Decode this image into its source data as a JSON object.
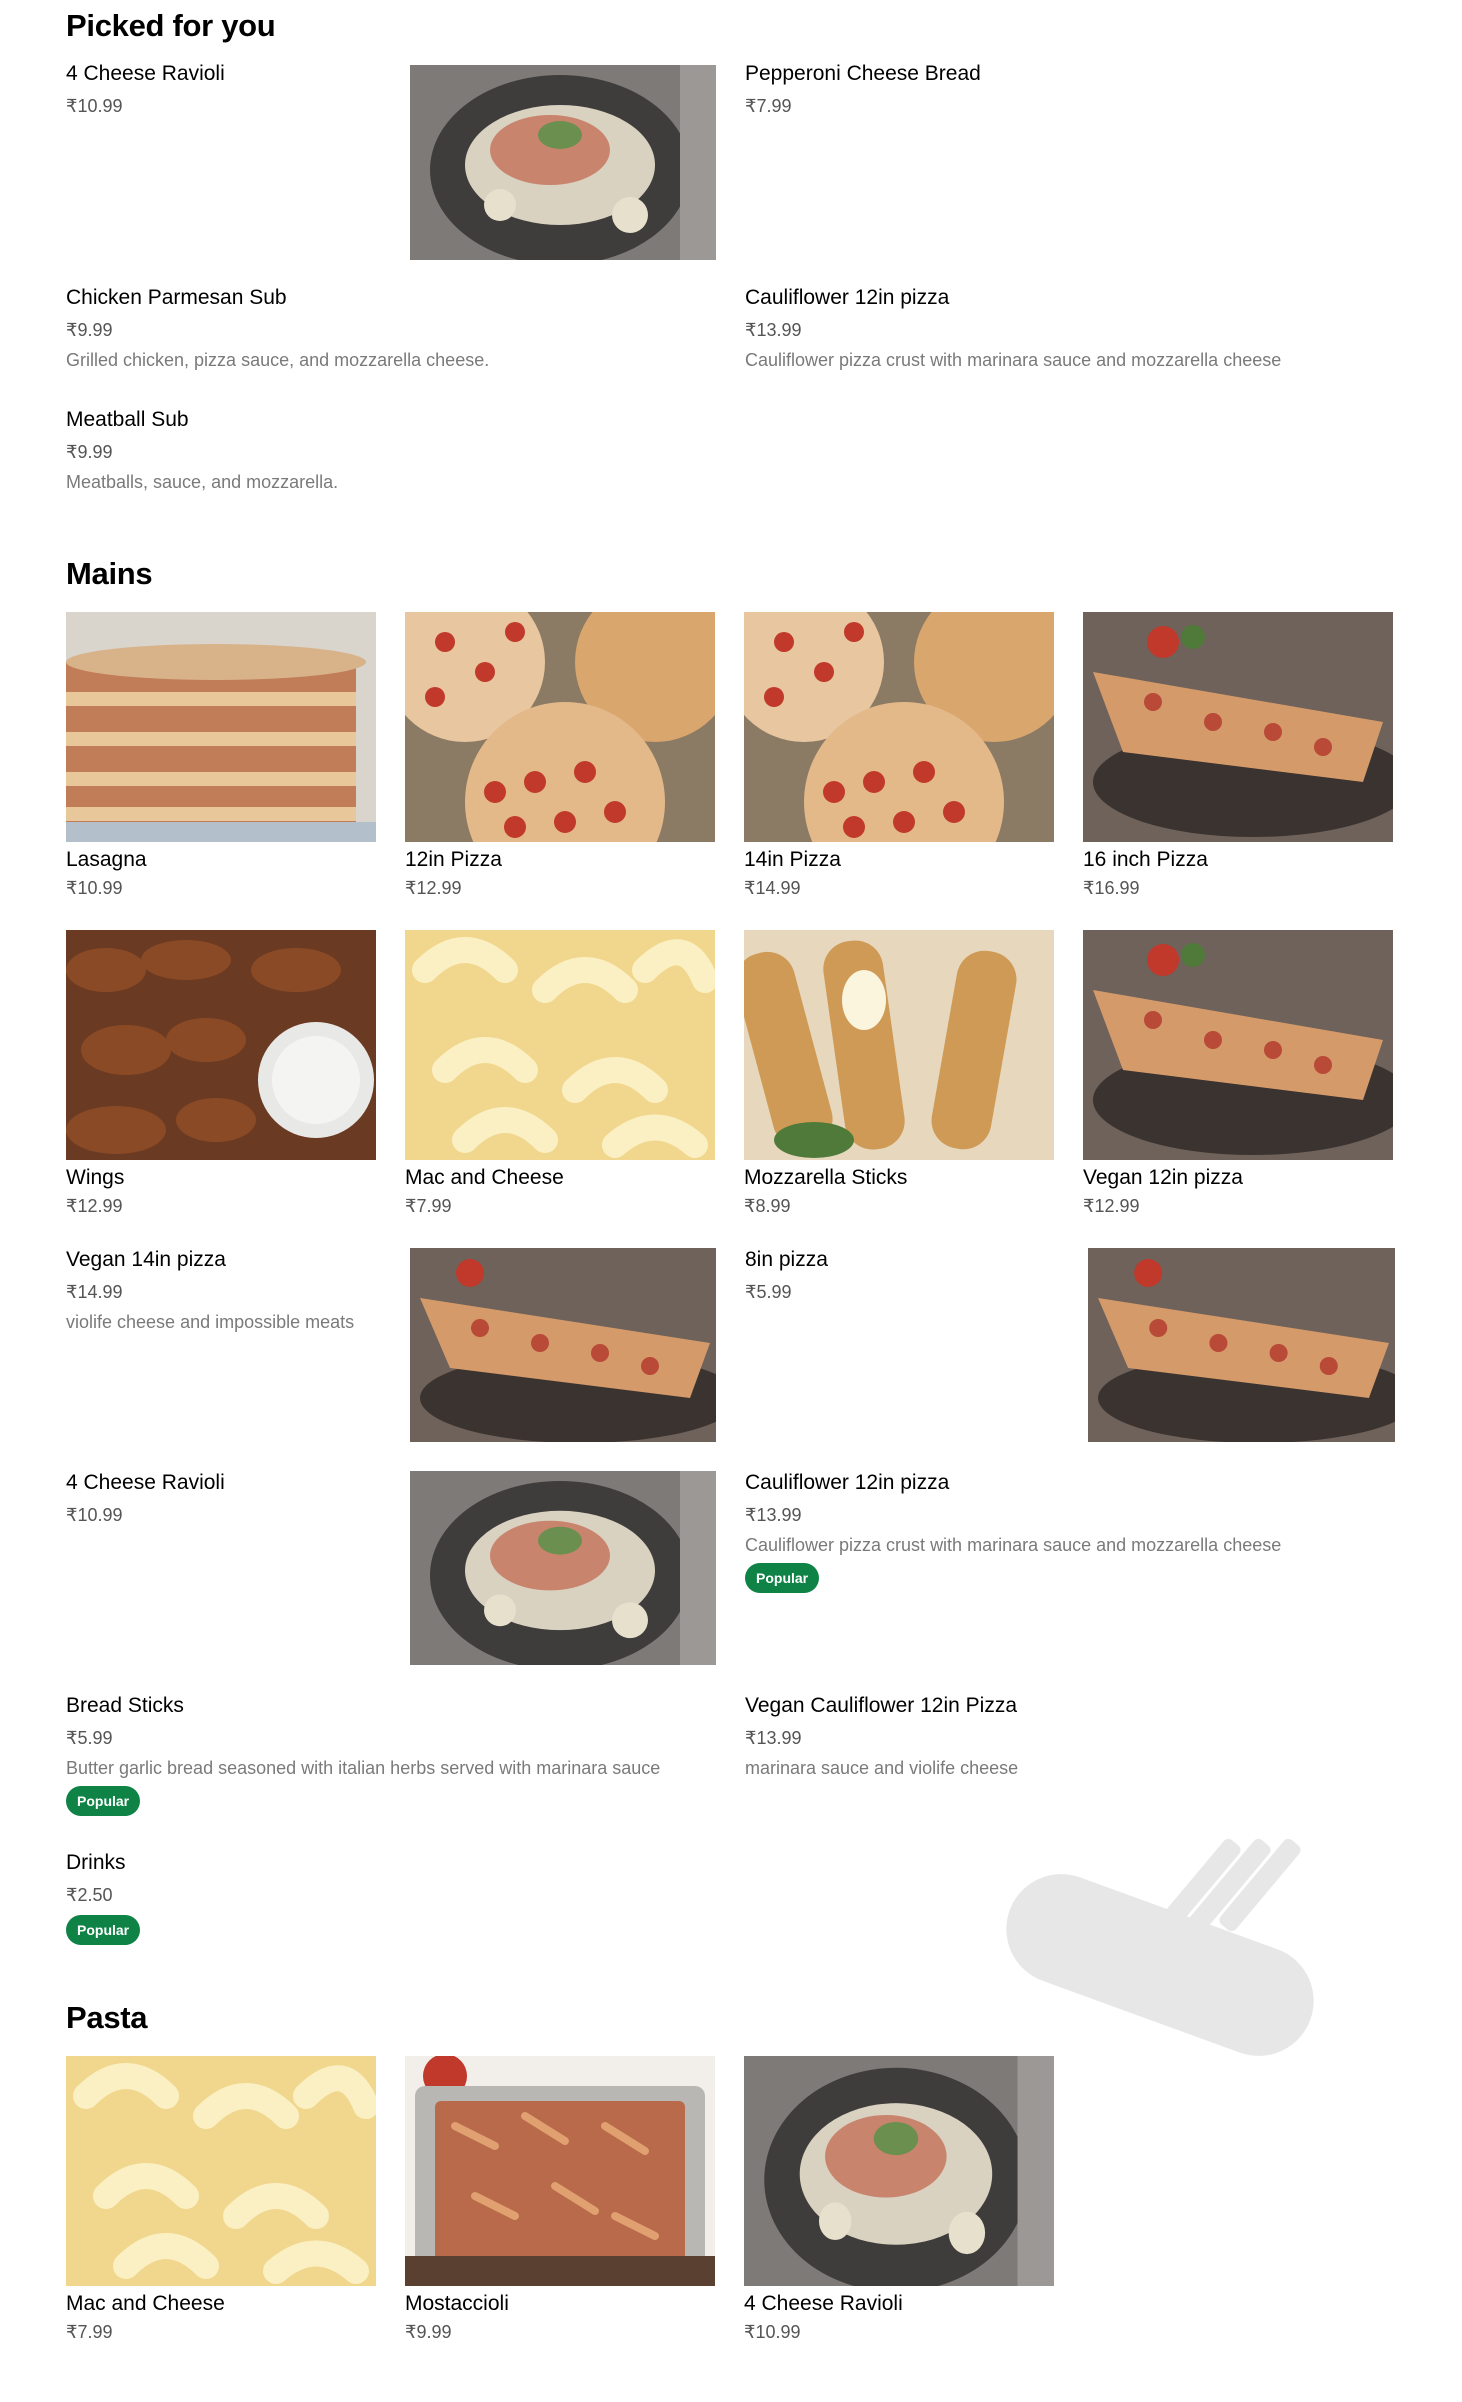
{
  "sections": {
    "picked": {
      "title": "Picked for you"
    },
    "mains": {
      "title": "Mains"
    },
    "pasta": {
      "title": "Pasta"
    }
  },
  "picked": {
    "ravioli": {
      "title": "4 Cheese Ravioli",
      "price": "₹10.99"
    },
    "pepperoni_bread": {
      "title": "Pepperoni Cheese Bread",
      "price": "₹7.99"
    },
    "chicken_sub": {
      "title": "Chicken Parmesan Sub",
      "price": "₹9.99",
      "desc": "Grilled chicken, pizza sauce, and mozzarella cheese."
    },
    "cauliflower": {
      "title": "Cauliflower 12in pizza",
      "price": "₹13.99",
      "desc": "Cauliflower pizza crust with marinara sauce and mozzarella cheese"
    },
    "meatball_sub": {
      "title": "Meatball Sub",
      "price": "₹9.99",
      "desc": "Meatballs, sauce, and mozzarella."
    }
  },
  "mains": {
    "lasagna": {
      "title": "Lasagna",
      "price": "₹10.99"
    },
    "pizza12": {
      "title": "12in Pizza",
      "price": "₹12.99"
    },
    "pizza14": {
      "title": "14in Pizza",
      "price": "₹14.99"
    },
    "pizza16": {
      "title": "16 inch Pizza",
      "price": "₹16.99"
    },
    "wings": {
      "title": "Wings",
      "price": "₹12.99"
    },
    "mac": {
      "title": "Mac and Cheese",
      "price": "₹7.99"
    },
    "mozz": {
      "title": "Mozzarella Sticks",
      "price": "₹8.99"
    },
    "vegan12": {
      "title": "Vegan 12in pizza",
      "price": "₹12.99"
    },
    "vegan14": {
      "title": "Vegan 14in pizza",
      "price": "₹14.99",
      "desc": "violife cheese and impossible meats"
    },
    "pizza8": {
      "title": "8in pizza",
      "price": "₹5.99"
    },
    "ravioli": {
      "title": "4 Cheese Ravioli",
      "price": "₹10.99"
    },
    "cauliflower": {
      "title": "Cauliflower 12in pizza",
      "price": "₹13.99",
      "desc": "Cauliflower pizza crust with marinara sauce and mozzarella cheese",
      "badge": "Popular"
    },
    "breadsticks": {
      "title": "Bread Sticks",
      "price": "₹5.99",
      "desc": "Butter garlic bread seasoned with italian herbs served with marinara sauce",
      "badge": "Popular"
    },
    "vegan_cauli": {
      "title": "Vegan Cauliflower 12in Pizza",
      "price": "₹13.99",
      "desc": "marinara sauce and violife cheese"
    },
    "drinks": {
      "title": "Drinks",
      "price": "₹2.50",
      "badge": "Popular"
    }
  },
  "pasta": {
    "mac": {
      "title": "Mac and Cheese",
      "price": "₹7.99"
    },
    "mostaccioli": {
      "title": "Mostaccioli",
      "price": "₹9.99"
    },
    "ravioli": {
      "title": "4 Cheese Ravioli",
      "price": "₹10.99"
    }
  },
  "images": {
    "ravioli": "ravioli-photo",
    "lasagna": "lasagna-photo",
    "pizzas": "pizza-trio-photo",
    "pizza_slice": "pizza-slice-photo",
    "wings": "wings-photo",
    "mac": "mac-and-cheese-photo",
    "mozz": "mozzarella-sticks-photo",
    "mostaccioli": "mostaccioli-tray-photo"
  },
  "watermark": {
    "icon": "fork-knife-icon"
  },
  "colors": {
    "badge": "#0e8345",
    "price": "#555555",
    "desc": "#7a7a7a",
    "title": "#000000"
  }
}
